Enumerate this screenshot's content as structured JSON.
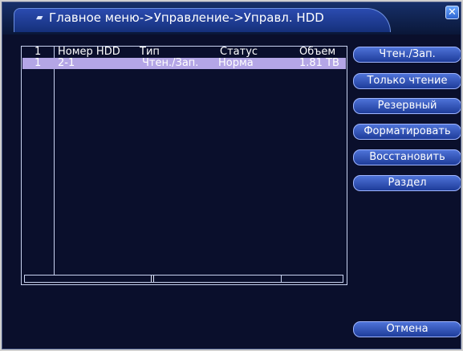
{
  "window": {
    "title": "Главное меню->Управление->Управл. HDD",
    "close_label": "✕"
  },
  "table": {
    "headers": {
      "index": "1",
      "hdd_number": "Номер HDD",
      "type": "Тип",
      "status": "Статус",
      "capacity": "Объем"
    },
    "rows": [
      {
        "index": "1",
        "hdd_number": "2-1",
        "type": "Чтен./Зап.",
        "status": "Норма",
        "capacity": "1.81 TB"
      }
    ]
  },
  "actions": {
    "read_write": "Чтен./Зап.",
    "read_only": "Только чтение",
    "backup": "Резервный",
    "format": "Форматировать",
    "restore": "Восстановить",
    "partition": "Раздел",
    "cancel": "Отмена"
  },
  "colors": {
    "background": "#0a0f2c",
    "selected_row": "#b4a6e6",
    "button": "#2f55c0"
  }
}
